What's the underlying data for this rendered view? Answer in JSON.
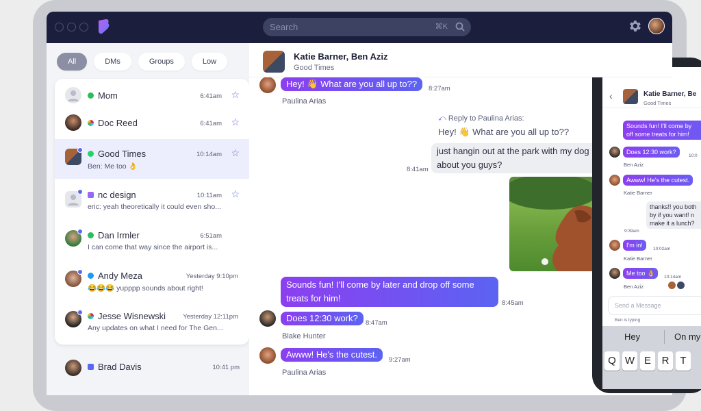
{
  "search": {
    "placeholder": "Search",
    "shortcut": "⌘K"
  },
  "filters": [
    {
      "label": "All",
      "active": true
    },
    {
      "label": "DMs"
    },
    {
      "label": "Groups"
    },
    {
      "label": "Low"
    }
  ],
  "conversations": [
    {
      "name": "Mom",
      "time": "6:41am",
      "preview": "",
      "platform": "green"
    },
    {
      "name": "Doc Reed",
      "time": "6:41am",
      "preview": "",
      "platform": "slack"
    },
    {
      "name": "Good Times",
      "time": "10:14am",
      "preview": "Ben: Me too 👌",
      "platform": "whatsapp"
    },
    {
      "name": "nc design",
      "time": "10:11am",
      "preview": "eric: yeah theoretically it could even sho...",
      "platform": "beeper"
    },
    {
      "name": "Dan Irmler",
      "time": "6:51am",
      "preview": "I can come that way since the airport is...",
      "platform": "green"
    },
    {
      "name": "Andy Meza",
      "time": "Yesterday 9:10pm",
      "preview": "😂😂😂 yupppp sounds about right!",
      "platform": "twitter"
    },
    {
      "name": "Jesse Wisnewski",
      "time": "Yesterday 12:11pm",
      "preview": "Any updates on what I need for The Gen...",
      "platform": "slack"
    }
  ],
  "extra_conversation": {
    "name": "Brad Davis",
    "time": "10:41 pm"
  },
  "chat": {
    "title": "Katie Barner, Ben Aziz",
    "subtitle": "Good Times",
    "m1": {
      "text": "Hey! 👋 What are you all up to??",
      "time": "8:27am",
      "sender": "Paulina Arias"
    },
    "reply": {
      "header": "Reply to Paulina Arias:",
      "quoted": "Hey! 👋 What are you all up to??"
    },
    "m2": {
      "line1": "just hangin out at the park with my dog",
      "line2": "about you guys?",
      "time": "8:41am"
    },
    "m3": {
      "line1": "Sounds fun! I'll come by later and drop off some",
      "line2": "treats for him!",
      "time": "8:45am"
    },
    "m4": {
      "text": "Does 12:30 work?",
      "time": "8:47am",
      "sender": "Blake Hunter"
    },
    "m5": {
      "text": "Awww! He's the cutest.",
      "time": "9:27am",
      "sender": "Paulina Arias"
    }
  },
  "phone": {
    "title": "Katie Barner, Be",
    "subtitle": "Good Times",
    "p1": {
      "line1": "Sounds fun! I'll come by",
      "line2": "off some treats for him!"
    },
    "p2": {
      "text": "Does 12:30 work?",
      "time": "10:0",
      "sender": "Ben Aziz"
    },
    "p3": {
      "text": "Awww! He's the cutest.",
      "sender": "Katie Barner"
    },
    "p4": {
      "line1": "thanks!! you both",
      "line2": "by if you want! n",
      "line3": "make it a lunch?",
      "time": "9:39am"
    },
    "p5": {
      "text": "I'm in!",
      "time": "10:02am",
      "sender": "Katie Barner"
    },
    "p6": {
      "text": "Me too 👌",
      "time": "10:14am",
      "sender": "Ben Aziz"
    },
    "input_placeholder": "Send a Message",
    "typing": "Ben is typing",
    "suggestions": [
      "Hey",
      "On my"
    ],
    "keys": [
      "Q",
      "W",
      "E",
      "R",
      "T"
    ]
  }
}
